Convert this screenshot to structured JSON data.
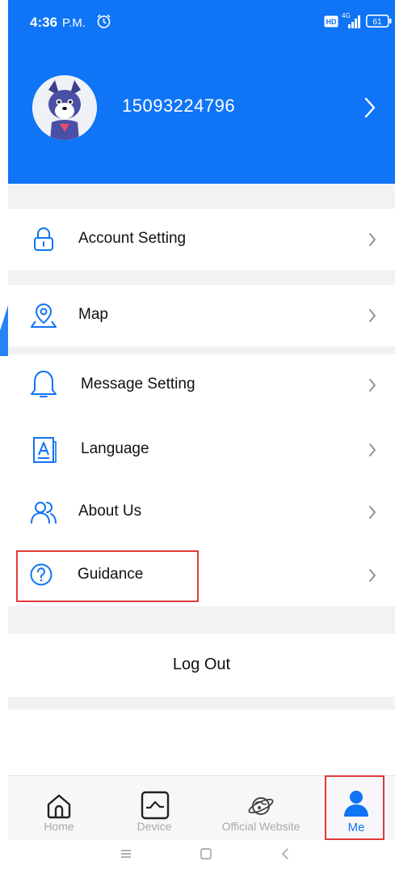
{
  "status_bar": {
    "time": "4:36",
    "ampm": "P.M.",
    "battery": "61",
    "network": "4G"
  },
  "profile": {
    "phone": "15093224796"
  },
  "menu": [
    {
      "label": "Account Setting",
      "icon": "lock-icon"
    },
    {
      "label": "Map",
      "icon": "map-pin-icon"
    },
    {
      "label": "Message Setting",
      "icon": "bell-icon"
    },
    {
      "label": "Language",
      "icon": "language-icon"
    },
    {
      "label": "About Us",
      "icon": "users-icon"
    },
    {
      "label": "Guidance",
      "icon": "help-circle-icon"
    }
  ],
  "logout": {
    "label": "Log Out"
  },
  "tabs": [
    {
      "label": "Home",
      "icon": "home-icon",
      "active": false
    },
    {
      "label": "Device",
      "icon": "device-icon",
      "active": false
    },
    {
      "label": "Official Website",
      "icon": "planet-icon",
      "active": false
    },
    {
      "label": "Me",
      "icon": "person-icon",
      "active": true
    }
  ],
  "colors": {
    "accent": "#0f74f5",
    "highlight": "#e13a3a",
    "separator": "#f2f2f4",
    "inactive_tab": "#a9a9ad"
  }
}
